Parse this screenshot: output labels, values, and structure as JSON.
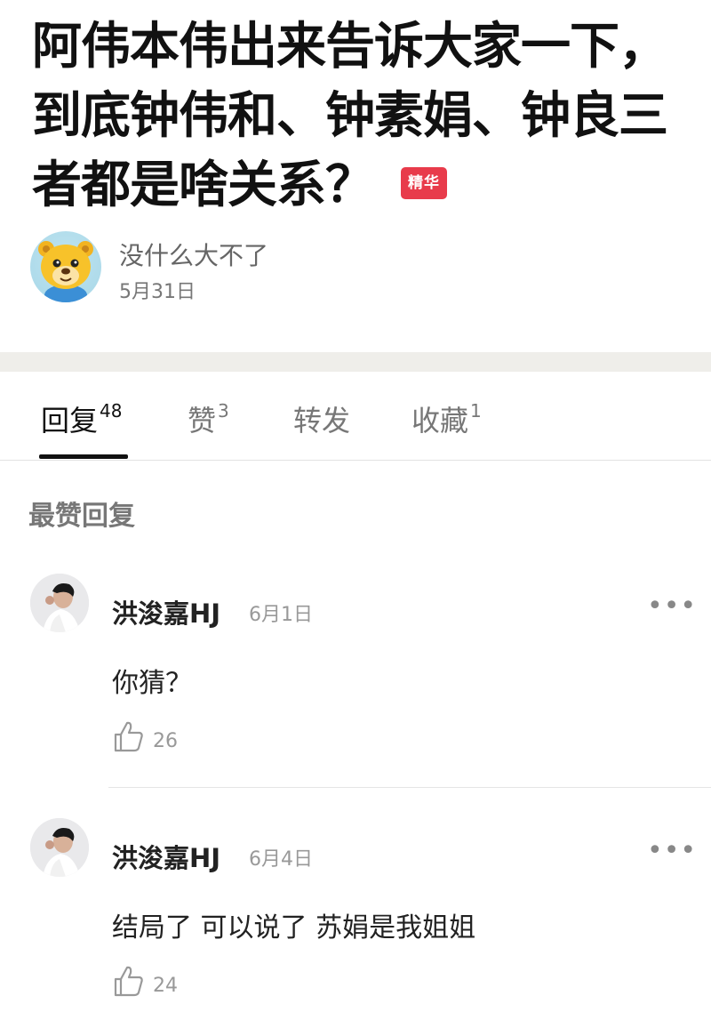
{
  "post": {
    "title": "阿伟本伟出来告诉大家一下，到底钟伟和、钟素娟、钟良三者都是啥关系？",
    "badge": "精华"
  },
  "author": {
    "name": "没什么大不了",
    "date": "5月31日",
    "avatar_icon": "cartoon-bear-icon"
  },
  "tabs": [
    {
      "label": "回复",
      "count": "48"
    },
    {
      "label": "赞",
      "count": "3"
    },
    {
      "label": "转发",
      "count": ""
    },
    {
      "label": "收藏",
      "count": "1"
    }
  ],
  "section": {
    "title": "最赞回复"
  },
  "replies": [
    {
      "name": "洪浚嘉HJ",
      "date": "6月1日",
      "text": "你猜？",
      "likes": "26",
      "more": "•••"
    },
    {
      "name": "洪浚嘉HJ",
      "date": "6月4日",
      "text": "结局了 可以说了 苏娟是我姐姐",
      "likes": "24",
      "more": "•••"
    }
  ],
  "colors": {
    "badge": "#e83b4b",
    "band": "#efeeea",
    "active_tab": "#111111"
  }
}
